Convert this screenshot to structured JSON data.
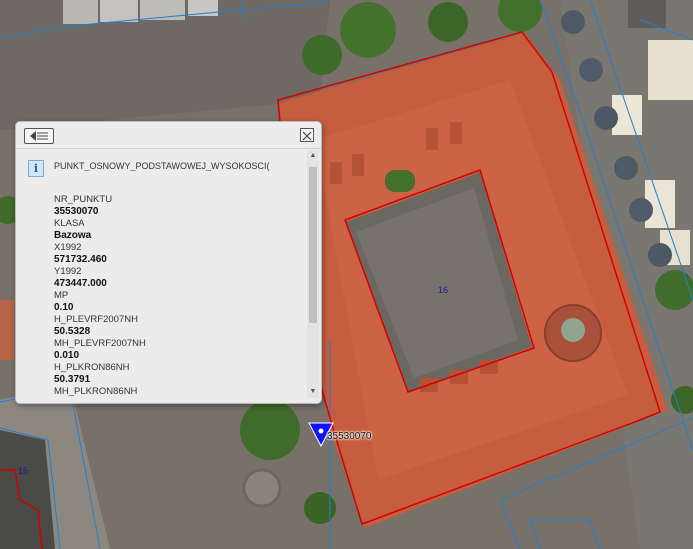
{
  "map": {
    "parcel_labels": [
      "16",
      "15"
    ],
    "colors": {
      "parcel_outline": "#1f7fd6",
      "building_outline": "#d40000",
      "marker": "#1010ff",
      "roof": "#c35a3c",
      "courtyard": "#6b6862"
    }
  },
  "marker": {
    "label": "35530070",
    "icon": "benchmark-triangle-icon"
  },
  "popup": {
    "back_icon": "back-arrow-icon",
    "close_icon": "close-icon",
    "info_icon": "info-icon",
    "info_symbol": "i",
    "title": "PUNKT_OSNOWY_PODSTAWOWEJ_WYSOKOSCI(",
    "attributes": [
      {
        "label": "NR_PUNKTU",
        "value": "35530070"
      },
      {
        "label": "KLASA",
        "value": "Bazowa"
      },
      {
        "label": "X1992",
        "value": "571732.460"
      },
      {
        "label": "Y1992",
        "value": "473447.000"
      },
      {
        "label": "MP",
        "value": "0.10"
      },
      {
        "label": "H_PLEVRF2007NH",
        "value": "50.5328"
      },
      {
        "label": "MH_PLEVRF2007NH",
        "value": "0.010"
      },
      {
        "label": "H_PLKRON86NH",
        "value": "50.3791"
      },
      {
        "label": "MH_PLKRON86NH",
        "value": ""
      }
    ]
  }
}
